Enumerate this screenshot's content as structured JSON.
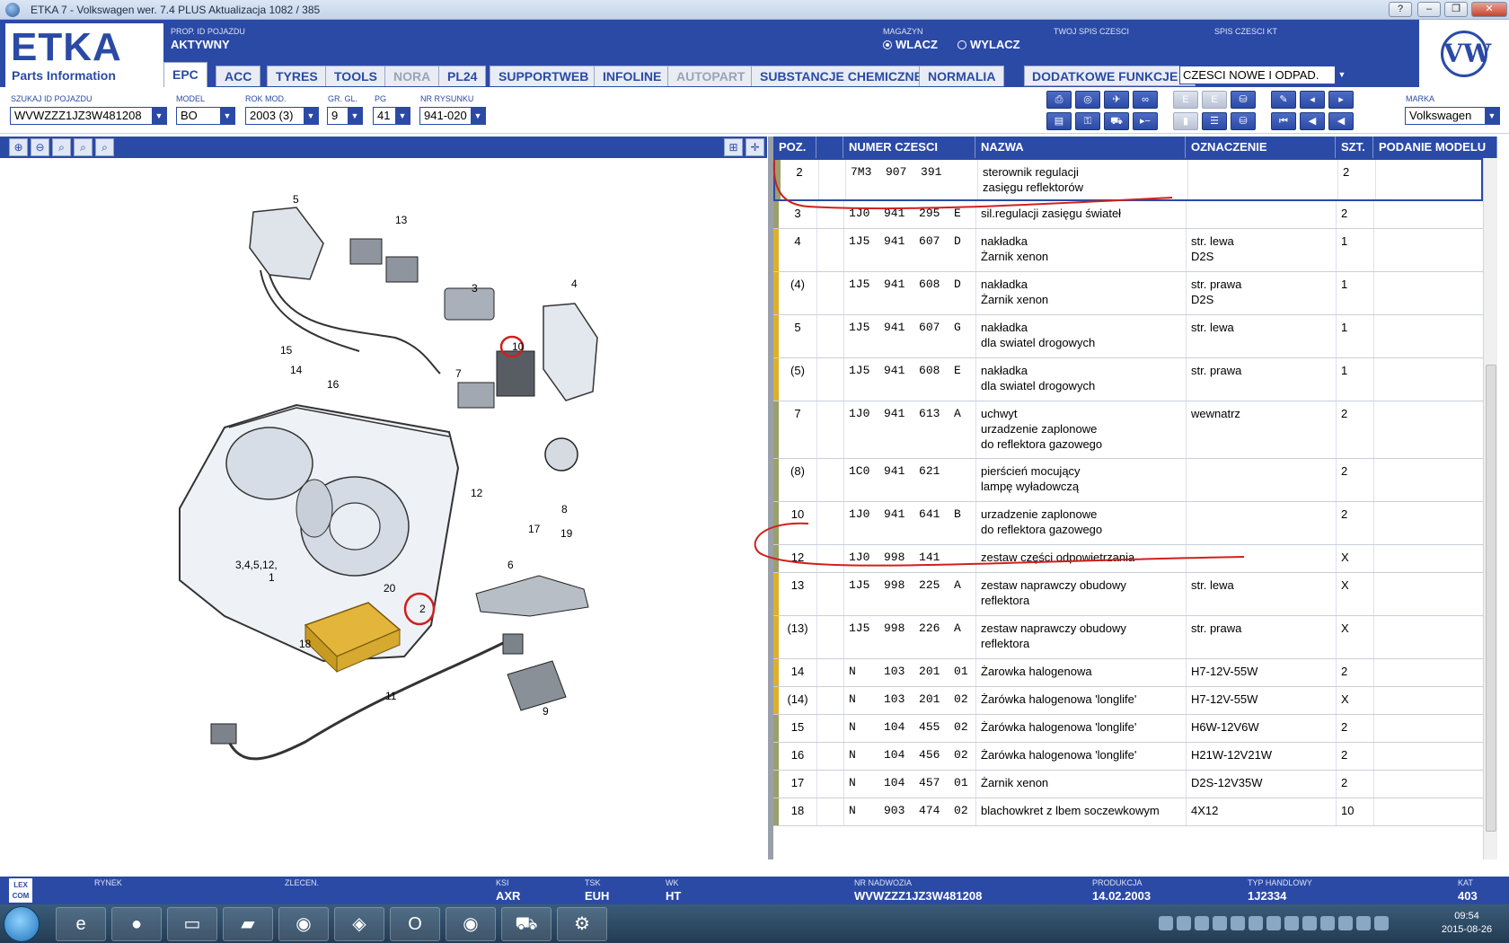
{
  "window": {
    "title": "ETKA 7 - Volkswagen wer. 7.4 PLUS Aktualizacja 1082 / 385",
    "buttons": [
      "?",
      "–",
      "❐",
      "✕"
    ]
  },
  "logo": {
    "title": "ETKA",
    "subtitle": "Parts Information"
  },
  "header": {
    "vehicle_label": "PROP. ID POJAZDU",
    "vehicle_value": "AKTYWNY",
    "magazyn_label": "MAGAZYN",
    "opt_on": "WLACZ",
    "opt_off": "WYLACZ",
    "spis_label": "TWOJ SPIS CZESCI",
    "spis_kt_label": "SPIS CZESCI KT"
  },
  "tabs": [
    {
      "label": "EPC",
      "state": "active"
    },
    {
      "label": "ACC",
      "state": "normal"
    },
    {
      "label": "TYRES",
      "state": "normal"
    },
    {
      "label": "TOOLS",
      "state": "normal"
    },
    {
      "label": "NORA",
      "state": "disabled"
    },
    {
      "label": "PL24",
      "state": "normal"
    },
    {
      "label": "SUPPORTWEB",
      "state": "normal"
    },
    {
      "label": "INFOLINE",
      "state": "normal"
    },
    {
      "label": "AUTOPART",
      "state": "disabled"
    },
    {
      "label": "SUBSTANCJE CHEMICZNE",
      "state": "normal"
    },
    {
      "label": "NORMALIA",
      "state": "normal"
    }
  ],
  "extra": {
    "label": "DODATKOWE FUNKCJE",
    "select": "CZESCI NOWE I ODPAD."
  },
  "search": {
    "vin_label": "SZUKAJ ID POJAZDU",
    "vin": "WVWZZZ1JZ3W481208",
    "model_label": "MODEL",
    "model": "BO",
    "year_label": "ROK MOD.",
    "year": "2003 (3)",
    "gr_label": "GR. GL.",
    "gr": "9",
    "pg_label": "PG",
    "pg": "41",
    "draw_label": "NR RYSUNKU",
    "draw": "941-020",
    "brand_label": "MARKA",
    "brand": "Volkswagen"
  },
  "drawing_labels": [
    "5",
    "13",
    "3",
    "4",
    "10",
    "15",
    "14",
    "16",
    "7",
    "12",
    "8",
    "17",
    "3,4,5,12,",
    "1",
    "20",
    "2",
    "19",
    "6",
    "18",
    "11",
    "9"
  ],
  "table": {
    "columns": [
      "POZ.",
      "NUMER CZESCI",
      "NAZWA",
      "OZNACZENIE",
      "SZT.",
      "PODANIE MODELU"
    ],
    "rows": [
      {
        "poz": "2",
        "num": "7M3  907  391",
        "nazwa": "sterownik regulacji\nzasięgu reflektorów",
        "ozn": "",
        "szt": "2",
        "mark": "g",
        "h": 48,
        "selected": true
      },
      {
        "poz": "3",
        "num": "1J0  941  295  E",
        "nazwa": "sil.regulacji zasięgu świateł",
        "ozn": "",
        "szt": "2",
        "mark": "g",
        "h": 31
      },
      {
        "poz": "4",
        "num": "1J5  941  607  D",
        "nazwa": "nakładka\nŻarnik xenon",
        "ozn": "str. lewa\nD2S",
        "szt": "1",
        "mark": "y",
        "h": 48
      },
      {
        "poz": "(4)",
        "num": "1J5  941  608  D",
        "nazwa": "nakładka\nŻarnik xenon",
        "ozn": "str. prawa\nD2S",
        "szt": "1",
        "mark": "y",
        "h": 48
      },
      {
        "poz": "5",
        "num": "1J5  941  607  G",
        "nazwa": "nakładka\ndla swiatel drogowych",
        "ozn": "str. lewa",
        "szt": "1",
        "mark": "y",
        "h": 48
      },
      {
        "poz": "(5)",
        "num": "1J5  941  608  E",
        "nazwa": "nakładka\ndla swiatel drogowych",
        "ozn": "str. prawa",
        "szt": "1",
        "mark": "y",
        "h": 48
      },
      {
        "poz": "7",
        "num": "1J0  941  613  A",
        "nazwa": "uchwyt\nurzadzenie zaplonowe\ndo reflektora gazowego",
        "ozn": "wewnatrz",
        "szt": "2",
        "mark": "g",
        "h": 64
      },
      {
        "poz": "(8)",
        "num": "1C0  941  621",
        "nazwa": "pierścień mocujący\nlampę wyładowczą",
        "ozn": "",
        "szt": "2",
        "mark": "g",
        "h": 48
      },
      {
        "poz": "10",
        "num": "1J0  941  641  B",
        "nazwa": "urzadzenie zaplonowe\ndo reflektora gazowego",
        "ozn": "",
        "szt": "2",
        "mark": "g",
        "h": 48
      },
      {
        "poz": "12",
        "num": "1J0  998  141",
        "nazwa": "zestaw części odpowietrzania",
        "ozn": "",
        "szt": "X",
        "mark": "g",
        "h": 31
      },
      {
        "poz": "13",
        "num": "1J5  998  225  A",
        "nazwa": "zestaw naprawczy obudowy\nreflektora",
        "ozn": "str. lewa",
        "szt": "X",
        "mark": "y",
        "h": 48
      },
      {
        "poz": "(13)",
        "num": "1J5  998  226  A",
        "nazwa": "zestaw naprawczy obudowy\nreflektora",
        "ozn": "str. prawa",
        "szt": "X",
        "mark": "y",
        "h": 48
      },
      {
        "poz": "14",
        "num": "N    103  201  01",
        "nazwa": "Żarowka halogenowa",
        "ozn": "H7-12V-55W",
        "szt": "2",
        "mark": "y",
        "h": 31
      },
      {
        "poz": "(14)",
        "num": "N    103  201  02",
        "nazwa": "Żarówka halogenowa 'longlife'",
        "ozn": "H7-12V-55W",
        "szt": "X",
        "mark": "y",
        "h": 31
      },
      {
        "poz": "15",
        "num": "N    104  455  02",
        "nazwa": "Żarówka halogenowa 'longlife'",
        "ozn": "H6W-12V6W",
        "szt": "2",
        "mark": "g",
        "h": 31
      },
      {
        "poz": "16",
        "num": "N    104  456  02",
        "nazwa": "Żarówka halogenowa 'longlife'",
        "ozn": "H21W-12V21W",
        "szt": "2",
        "mark": "g",
        "h": 31
      },
      {
        "poz": "17",
        "num": "N    104  457  01",
        "nazwa": "Żarnik xenon",
        "ozn": "D2S-12V35W",
        "szt": "2",
        "mark": "g",
        "h": 31
      },
      {
        "poz": "18",
        "num": "N    903  474  02",
        "nazwa": "blachowkret z lbem soczewkowym",
        "ozn": "4X12",
        "szt": "10",
        "mark": "g",
        "h": 31
      }
    ]
  },
  "status": {
    "rynek_label": "RYNEK",
    "zlecen_label": "ZLECEN.",
    "ksi_label": "KSI",
    "ksi": "AXR",
    "tsk_label": "TSK",
    "tsk": "EUH",
    "wk_label": "WK",
    "wk": "HT",
    "nadw_label": "NR NADWOZIA",
    "nadw": "WVWZZZ1JZ3W481208",
    "prod_label": "PRODUKCJA",
    "prod": "14.02.2003",
    "typ_label": "TYP HANDLOWY",
    "typ": "1J2334",
    "kat_label": "KAT",
    "kat": "403",
    "lexcom": "LEX COM"
  },
  "clock": {
    "time": "09:54",
    "date": "2015-08-26"
  },
  "colors": {
    "brand_blue": "#2b4aa6",
    "highlight_red": "#d0201e",
    "ecu_yellow": "#e3b53a"
  }
}
